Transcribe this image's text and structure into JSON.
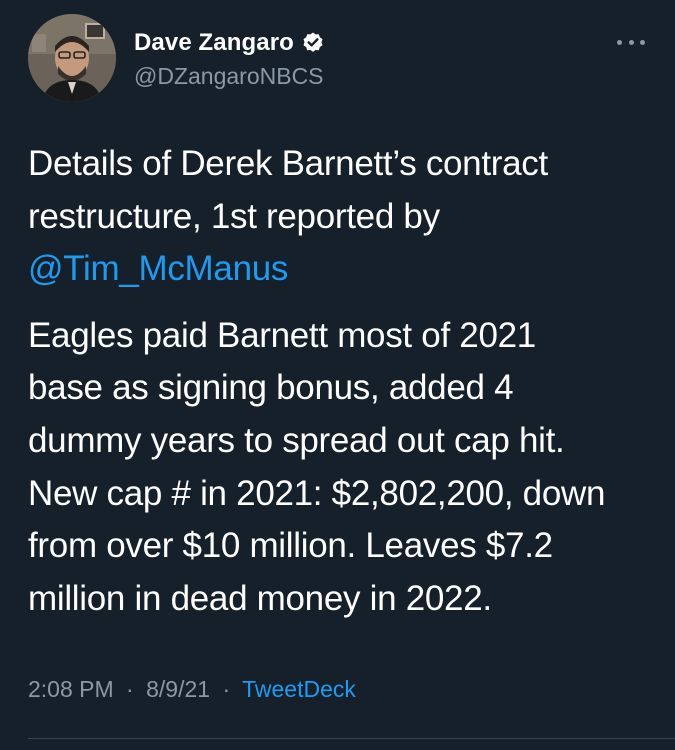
{
  "author": {
    "display_name": "Dave Zangaro",
    "handle": "@DZangaroNBCS",
    "verified": true,
    "avatar_icon": "profile-photo"
  },
  "more_icon": "ellipsis-icon",
  "tweet": {
    "para1": {
      "line1": "Details of Derek Barnett’s contract",
      "line2": "restructure, 1st reported by",
      "mention": "@Tim_McManus"
    },
    "para2": {
      "line1": "Eagles paid Barnett most of 2021",
      "line2": "base as signing bonus, added 4",
      "line3": "dummy years to spread out cap hit.",
      "line4": "New cap # in 2021: $2,802,200, down",
      "line5": "from over $10 million. Leaves $7.2",
      "line6": "million in dead money in 2022."
    }
  },
  "meta": {
    "time": "2:08 PM",
    "separator": "·",
    "date": "8/9/21",
    "source": "TweetDeck"
  },
  "colors": {
    "background": "#15202b",
    "link": "#1d9bf0",
    "secondary_text": "#8b98a5"
  }
}
